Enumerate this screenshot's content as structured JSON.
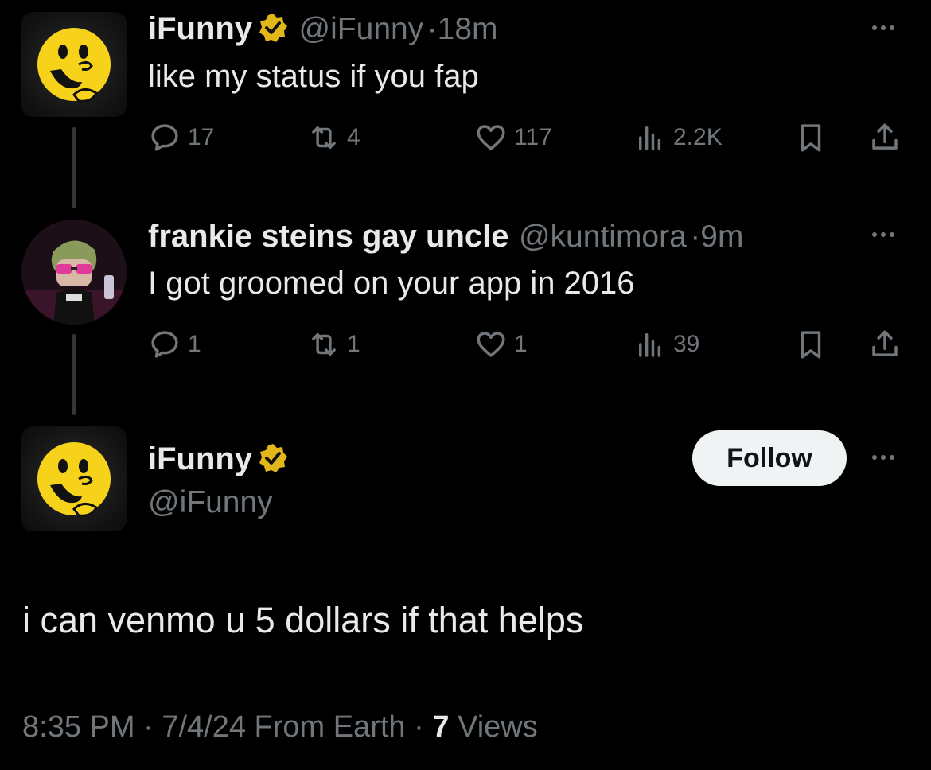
{
  "colors": {
    "background": "#000000",
    "text": "#e7e9ea",
    "muted": "#71767b",
    "verified": "#e2b719",
    "line": "#333639"
  },
  "tweets": [
    {
      "name": "iFunny",
      "verified": true,
      "handle": "@iFunny",
      "time": "18m",
      "text": "like my status if you fap",
      "metrics": {
        "replies": "17",
        "reposts": "4",
        "likes": "117",
        "views": "2.2K"
      }
    },
    {
      "name": "frankie steins gay uncle",
      "verified": false,
      "handle": "@kuntimora",
      "time": "9m",
      "text": "I got groomed on your app in 2016",
      "metrics": {
        "replies": "1",
        "reposts": "1",
        "likes": "1",
        "views": "39"
      }
    }
  ],
  "main_tweet": {
    "name": "iFunny",
    "verified": true,
    "handle": "@iFunny",
    "follow_label": "Follow",
    "text": "i can venmo u 5 dollars if that helps",
    "time": "8:35 PM",
    "date": "7/4/24",
    "location": "From Earth",
    "views_count": "7",
    "views_label": "Views"
  },
  "separator": "·",
  "icons": [
    "reply-icon",
    "repost-icon",
    "like-icon",
    "views-icon",
    "bookmark-icon",
    "share-icon",
    "more-icon",
    "verified-badge-icon"
  ]
}
